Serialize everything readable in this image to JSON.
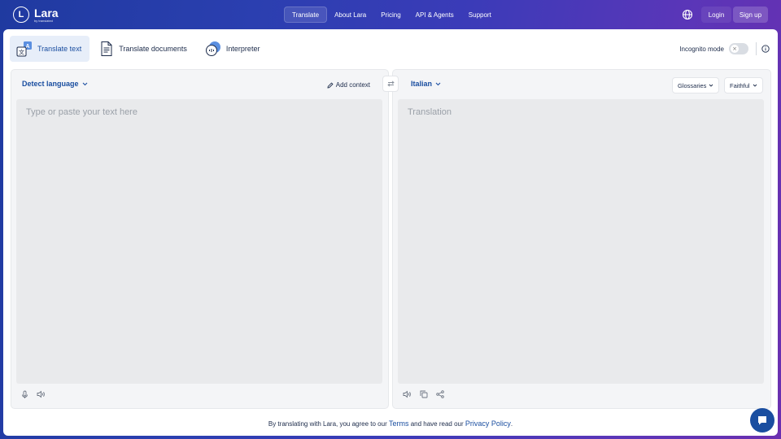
{
  "brand": {
    "name": "Lara",
    "sub": "by translated",
    "mark": "L"
  },
  "nav": {
    "items": [
      {
        "label": "Translate",
        "active": true
      },
      {
        "label": "About Lara",
        "active": false
      },
      {
        "label": "Pricing",
        "active": false
      },
      {
        "label": "API & Agents",
        "active": false
      },
      {
        "label": "Support",
        "active": false
      }
    ],
    "login_label": "Login",
    "signup_label": "Sign up"
  },
  "modes": {
    "tabs": [
      {
        "label": "Translate text",
        "icon": "translate-text-icon",
        "active": true
      },
      {
        "label": "Translate documents",
        "icon": "document-icon",
        "active": false
      },
      {
        "label": "Interpreter",
        "icon": "interpreter-icon",
        "active": false
      }
    ],
    "incognito_label": "Incognito mode",
    "incognito_on": false
  },
  "source": {
    "language": "Detect language",
    "add_context_label": "Add context",
    "placeholder": "Type or paste your text here"
  },
  "target": {
    "language": "Italian",
    "glossaries_label": "Glossaries",
    "style_label": "Faithful",
    "placeholder": "Translation"
  },
  "footer": {
    "prefix": "By translating with Lara, you agree to our",
    "terms": "Terms",
    "middle": "and have read our",
    "privacy": "Privacy Policy",
    "suffix": "."
  },
  "colors": {
    "accent": "#1a4ea0",
    "panel": "#f4f5f7",
    "input": "#e9eaec"
  }
}
